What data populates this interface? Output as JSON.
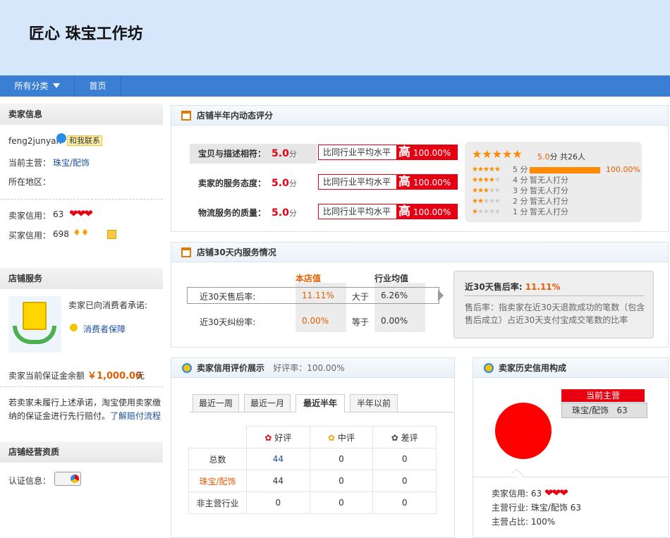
{
  "shop": {
    "title": "匠心 珠宝工作坊"
  },
  "nav": {
    "all_categories": "所有分类",
    "home": "首页"
  },
  "seller_info": {
    "heading": "卖家信息",
    "username": "feng2junyan",
    "contact_label": "和我联系",
    "main_business_label": "当前主营：",
    "main_business_value": "珠宝/配饰",
    "location_label": "所在地区：",
    "seller_credit_label": "卖家信用：",
    "seller_credit_value": "63",
    "buyer_credit_label": "买家信用：",
    "buyer_credit_value": "698"
  },
  "shop_service": {
    "heading": "店铺服务",
    "promise_text": "卖家已向消费者承诺:",
    "protection_link": "消费者保障",
    "deposit_label": "卖家当前保证金余额",
    "deposit_amount": "￥1,000.00",
    "deposit_unit": "元",
    "note_line1": "若卖家未履行上述承诺，淘宝使用卖家缴",
    "note_line2": "纳的保证金进行先行赔付。",
    "note_link": "了解赔付流程"
  },
  "qualification": {
    "heading": "店铺经营资质",
    "cert_label": "认证信息："
  },
  "dynamic_rating": {
    "heading": "店铺半年内动态评分",
    "rows": [
      {
        "label": "宝贝与描述相符：",
        "value": "5.0",
        "unit": "分",
        "compare": "比同行业平均水平",
        "level": "高",
        "percent": "100.00%"
      },
      {
        "label": "卖家的服务态度：",
        "value": "5.0",
        "unit": "分",
        "compare": "比同行业平均水平",
        "level": "高",
        "percent": "100.00%"
      },
      {
        "label": "物流服务的质量：",
        "value": "5.0",
        "unit": "分",
        "compare": "比同行业平均水平",
        "level": "高",
        "percent": "100.00%"
      }
    ],
    "summary_score": "5.0",
    "summary_unit": "分",
    "summary_count": "共26人",
    "breakdown": [
      {
        "stars": 5,
        "label": "5 分",
        "text": "100.00%",
        "fill": 1.0
      },
      {
        "stars": 4,
        "label": "4 分",
        "text": "暂无人打分",
        "fill": 0
      },
      {
        "stars": 3,
        "label": "3 分",
        "text": "暂无人打分",
        "fill": 0
      },
      {
        "stars": 2,
        "label": "2 分",
        "text": "暂无人打分",
        "fill": 0
      },
      {
        "stars": 1,
        "label": "1 分",
        "text": "暂无人打分",
        "fill": 0
      }
    ]
  },
  "service_30": {
    "heading": "店铺30天内服务情况",
    "col_shop": "本店值",
    "col_industry": "行业均值",
    "rows": [
      {
        "label": "近30天售后率:",
        "shop": "11.11%",
        "relation": "大于",
        "industry": "6.26%"
      },
      {
        "label": "近30天纠纷率:",
        "shop": "0.00%",
        "relation": "等于",
        "industry": "0.00%"
      }
    ],
    "tip_title": "近30天售后率:",
    "tip_value": "11.11%",
    "tip_desc": "售后率：指卖家在近30天退款成功的笔数（包含售后成立）占近30天支付宝成交笔数的比率"
  },
  "credit_review": {
    "heading": "卖家信用评价展示",
    "good_rate": "好评率：100.00%",
    "tabs": [
      "最近一周",
      "最近一月",
      "最近半年",
      "半年以前"
    ],
    "active_tab": 2,
    "columns": [
      "好评",
      "中评",
      "差评"
    ],
    "rows": [
      {
        "label": "总数",
        "values": [
          "44",
          "0",
          "0"
        ]
      },
      {
        "label": "珠宝/配饰",
        "values": [
          "44",
          "0",
          "0"
        ]
      },
      {
        "label": "非主营行业",
        "values": [
          "0",
          "0",
          "0"
        ]
      }
    ]
  },
  "history": {
    "heading": "卖家历史信用构成",
    "badge": "当前主营",
    "category": "珠宝/配饰",
    "category_value": "63",
    "seller_credit_label": "卖家信用:",
    "seller_credit_value": "63",
    "industry_label": "主营行业:",
    "industry_value": "珠宝/配饰 63",
    "ratio_label": "主营占比:",
    "ratio_value": "100%",
    "colors": {
      "pie": "#ff0000"
    }
  }
}
